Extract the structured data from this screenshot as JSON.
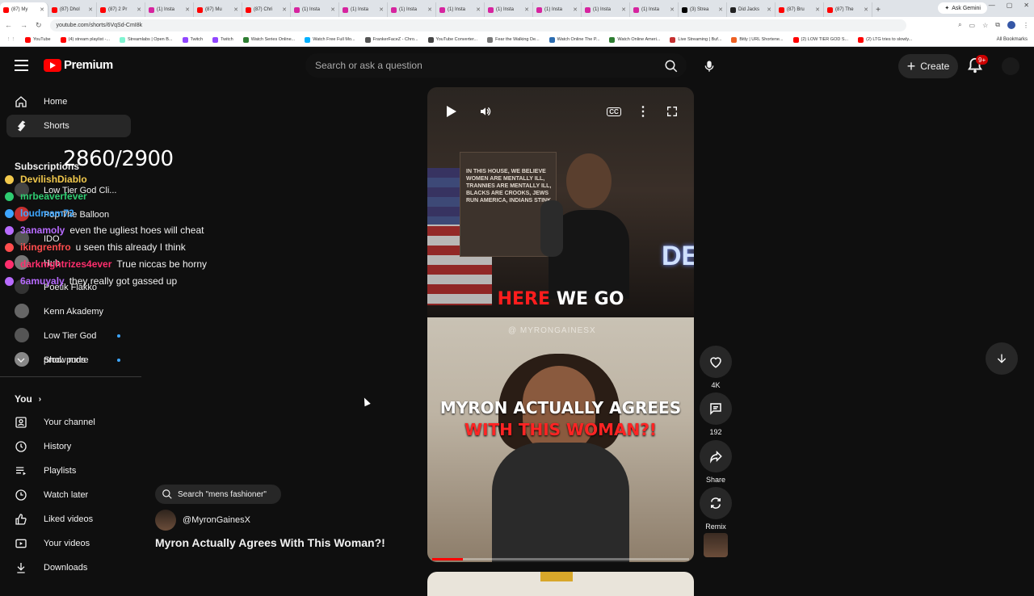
{
  "browser": {
    "tabs": [
      {
        "label": "(87) My",
        "color": "#ff0000",
        "active": true
      },
      {
        "label": "(87) Dhol",
        "color": "#ff0000"
      },
      {
        "label": "(87) 2 Pr",
        "color": "#ff0000"
      },
      {
        "label": "(1) Insta",
        "color": "#d6249f"
      },
      {
        "label": "(87) Mu",
        "color": "#ff0000"
      },
      {
        "label": "(87) Chri",
        "color": "#ff0000"
      },
      {
        "label": "(1) Insta",
        "color": "#d6249f"
      },
      {
        "label": "(1) Insta",
        "color": "#d6249f"
      },
      {
        "label": "(1) Insta",
        "color": "#d6249f"
      },
      {
        "label": "(1) Insta",
        "color": "#d6249f"
      },
      {
        "label": "(1) Insta",
        "color": "#d6249f"
      },
      {
        "label": "(1) Insta",
        "color": "#d6249f"
      },
      {
        "label": "(1) Insta",
        "color": "#d6249f"
      },
      {
        "label": "(1) Insta",
        "color": "#d6249f"
      },
      {
        "label": "(3) Strea",
        "color": "#000000"
      },
      {
        "label": "Did Jacks",
        "color": "#222222"
      },
      {
        "label": "(87) Bru",
        "color": "#ff0000"
      },
      {
        "label": "(87) The",
        "color": "#ff0000"
      }
    ],
    "new_tab": "+",
    "gemini_label": "Ask Gemini",
    "url": "youtube.com/shorts/6VqSd-CmI8k",
    "bookmarks": [
      {
        "label": "YouTube",
        "color": "#ff0000"
      },
      {
        "label": "(4) stream playlist -...",
        "color": "#ff0000"
      },
      {
        "label": "Streamlabs | Open B...",
        "color": "#80f5d2"
      },
      {
        "label": "Twitch",
        "color": "#9146ff"
      },
      {
        "label": "Twitch",
        "color": "#9146ff"
      },
      {
        "label": "Watch Series Online...",
        "color": "#2e7d32"
      },
      {
        "label": "Watch Free Full Mo...",
        "color": "#00b0ff"
      },
      {
        "label": "FrankerFaceZ - Chro...",
        "color": "#555555"
      },
      {
        "label": "YouTube Converter...",
        "color": "#444444"
      },
      {
        "label": "Fear the Walking De...",
        "color": "#777777"
      },
      {
        "label": "Watch Online The P...",
        "color": "#2b6cb0"
      },
      {
        "label": "Watch Online Ameri...",
        "color": "#2e7d32"
      },
      {
        "label": "Live Streaming | Buf...",
        "color": "#c53030"
      },
      {
        "label": "Bitly | URL Shortene...",
        "color": "#ee6123"
      },
      {
        "label": "(2) LOW TIER GOD S...",
        "color": "#ff0000"
      },
      {
        "label": "(2) LTG tries to slowly...",
        "color": "#ff0000"
      }
    ],
    "all_bookmarks": "All Bookmarks"
  },
  "header": {
    "logo_text": "Premium",
    "search_placeholder": "Search or ask a question",
    "create_label": "Create",
    "notification_count": "9+"
  },
  "sidebar": {
    "items": [
      {
        "label": "Home",
        "icon": "home-icon"
      },
      {
        "label": "Shorts",
        "icon": "shorts-icon",
        "active": true
      }
    ],
    "subscriptions_title": "Subscriptions",
    "subscriptions": [
      {
        "label": "Low Tier God Cli...",
        "color": "#444444"
      },
      {
        "label": "Pop The Balloon",
        "color": "#c53030"
      },
      {
        "label": "IDO",
        "color": "#555555"
      },
      {
        "label": "Hub",
        "color": "#777777"
      },
      {
        "label": "Poetik Flakko",
        "color": "#333333"
      },
      {
        "label": "Kenn Akademy",
        "color": "#666666"
      },
      {
        "label": "Low Tier God",
        "color": "#555555"
      },
      {
        "label": "prod. purls",
        "color": "#888888"
      }
    ],
    "show_more": "Show more",
    "you_title": "You",
    "you_items": [
      {
        "label": "Your channel",
        "icon": "channel-icon"
      },
      {
        "label": "History",
        "icon": "history-icon"
      },
      {
        "label": "Playlists",
        "icon": "playlists-icon"
      },
      {
        "label": "Watch later",
        "icon": "watch-later-icon"
      },
      {
        "label": "Liked videos",
        "icon": "like-icon"
      },
      {
        "label": "Your videos",
        "icon": "your-videos-icon"
      },
      {
        "label": "Downloads",
        "icon": "downloads-icon"
      }
    ]
  },
  "overlay": {
    "counter": "2860/2900",
    "chat": [
      {
        "user": "DevilishDiablo",
        "msg": "",
        "color": "#f2c94c"
      },
      {
        "user": "mrbeaverfever",
        "msg": "",
        "color": "#2ecc71"
      },
      {
        "user": "loudmam72",
        "msg": "",
        "color": "#3ea6ff"
      },
      {
        "user": "3anamoly",
        "msg": "even the ugliest hoes will cheat",
        "color": "#b86bff"
      },
      {
        "user": "ikingrenfro",
        "msg": "u seen this already I think",
        "color": "#ff4d4d"
      },
      {
        "user": "darknightrizes4ever",
        "msg": "True niccas be horny",
        "color": "#ff2e6d"
      },
      {
        "user": "6amuyaly",
        "msg": "they really got gassed up",
        "color": "#b86bff"
      }
    ]
  },
  "short": {
    "poster_text": "IN THIS HOUSE, WE BELIEVE WOMEN ARE MENTALLY ILL, TRANNIES ARE MENTALLY ILL, BLACKS ARE CROOKS, JEWS RUN AMERICA, INDIANS STINK",
    "neon_text": "DE",
    "caption_red": "HERE",
    "caption_white": "WE GO",
    "watermark": "@ MYRONGAINESX",
    "headline_line1": "MYRON ACTUALLY AGREES",
    "headline_line2": "WITH THIS WOMAN?!",
    "progress": 0.12,
    "cc_label": "CC"
  },
  "actions": {
    "likes": "4K",
    "comments": "192",
    "share": "Share",
    "remix": "Remix"
  },
  "meta": {
    "search_chip": "Search \"mens fashioner\"",
    "channel": "@MyronGainesX",
    "title": "Myron Actually Agrees With This Woman?!"
  }
}
